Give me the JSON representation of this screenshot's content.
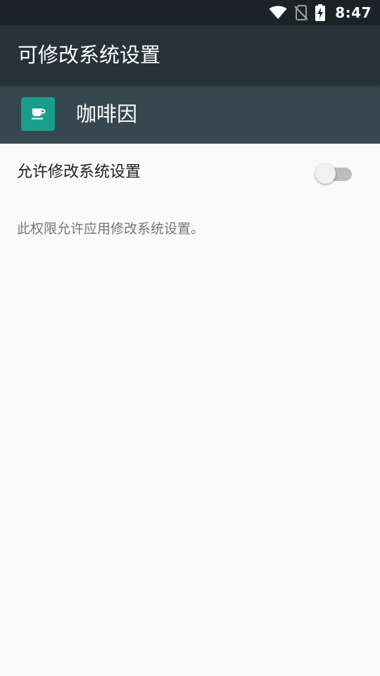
{
  "status_bar": {
    "time": "8:47",
    "icons": [
      "wifi-icon",
      "no-sim-icon",
      "battery-charging-icon"
    ]
  },
  "app_bar": {
    "title": "可修改系统设置"
  },
  "app_header": {
    "app_name": "咖啡因",
    "icon": "coffee-cup-icon",
    "icon_color": "#1a9e8c"
  },
  "setting": {
    "title": "允许修改系统设置",
    "enabled": false
  },
  "summary": "此权限允许应用修改系统设置。",
  "colors": {
    "status_bar": "#1c2326",
    "app_bar": "#263238",
    "app_header": "#37474f",
    "background": "#fafafa"
  }
}
